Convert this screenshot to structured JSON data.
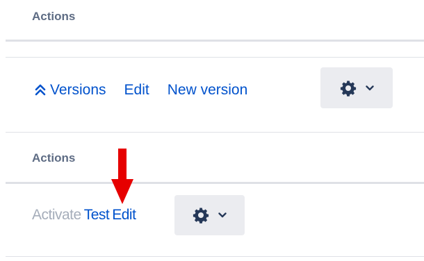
{
  "top_panel": {
    "header": "Actions"
  },
  "versions_panel": {
    "collapse_icon": "double-chevron-up-icon",
    "versions_label": "Versions",
    "edit_label": "Edit",
    "new_version_label": "New version",
    "gear_icon": "gear-icon",
    "dropdown_icon": "chevron-down-icon"
  },
  "actions_panel": {
    "header": "Actions",
    "activate_label": "Activate",
    "test_label": "Test",
    "edit_label": "Edit",
    "gear_icon": "gear-icon",
    "dropdown_icon": "chevron-down-icon"
  },
  "annotation": {
    "arrow_icon": "red-down-arrow-icon",
    "color": "#e60000"
  },
  "colors": {
    "link": "#0052cc",
    "disabled_link": "#a5adba",
    "header_text": "#5e6c84",
    "button_bg": "#ebecf0",
    "rule": "#dfe1e6"
  }
}
